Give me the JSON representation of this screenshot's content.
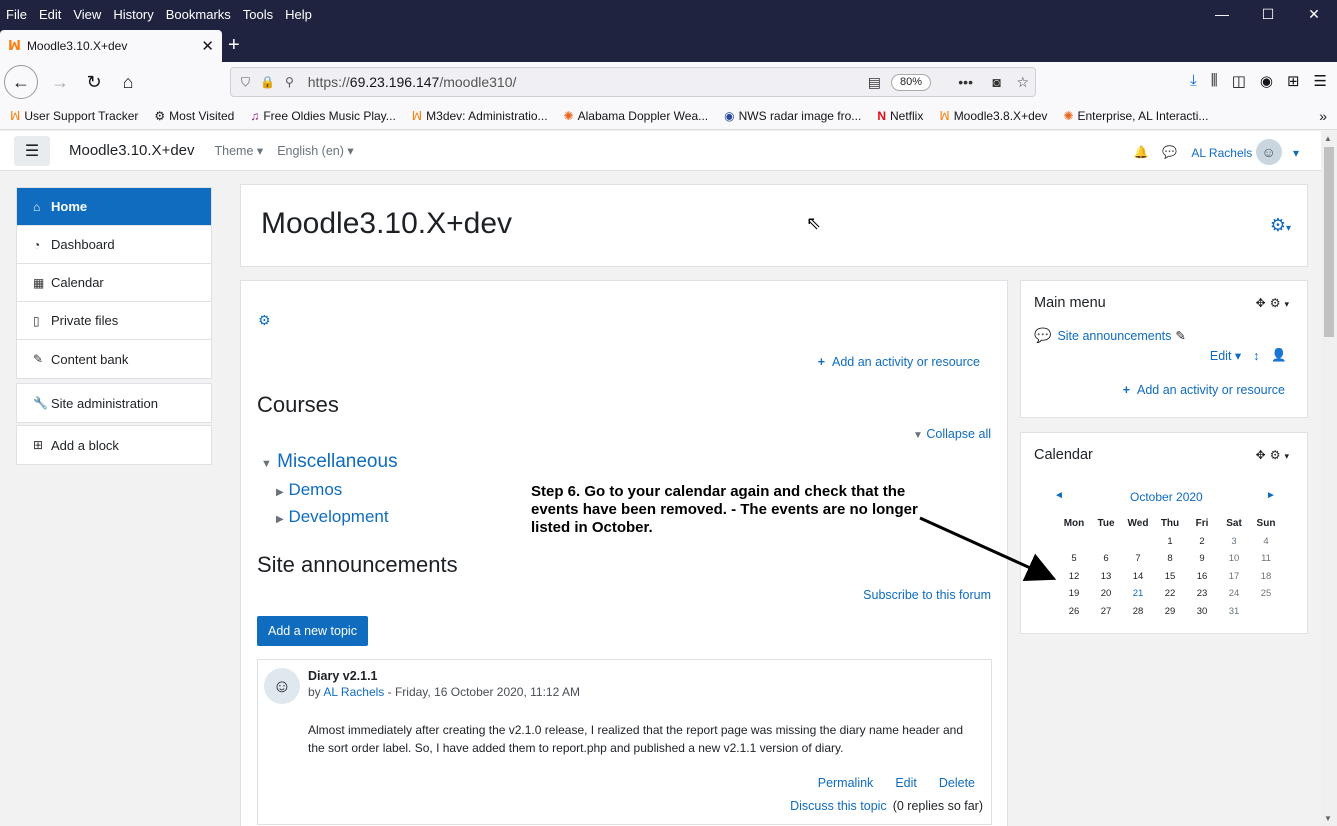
{
  "browser": {
    "menu": [
      "File",
      "Edit",
      "View",
      "History",
      "Bookmarks",
      "Tools",
      "Help"
    ],
    "tab_title": "Moodle3.10.X+dev",
    "url_prefix": "https://",
    "url_host": "69.23.196.147",
    "url_path": "/moodle310/",
    "zoom": "80%",
    "bookmarks": [
      {
        "icon": "ꟽ",
        "label": "User Support Tracker"
      },
      {
        "icon": "⚙",
        "label": "Most Visited"
      },
      {
        "icon": "♫",
        "label": "Free Oldies Music Play..."
      },
      {
        "icon": "ꟽ",
        "label": "M3dev: Administratio..."
      },
      {
        "icon": "✺",
        "label": "Alabama Doppler Wea..."
      },
      {
        "icon": "◉",
        "label": "NWS radar image fro..."
      },
      {
        "icon": "N",
        "label": "Netflix"
      },
      {
        "icon": "ꟽ",
        "label": "Moodle3.8.X+dev"
      },
      {
        "icon": "✺",
        "label": "Enterprise, AL Interacti..."
      }
    ]
  },
  "moodle_nav": {
    "site_name": "Moodle3.10.X+dev",
    "theme": "Theme",
    "language": "English (en)",
    "user": "AL Rachels"
  },
  "drawer": {
    "group1": [
      "Home",
      "Dashboard",
      "Calendar",
      "Private files",
      "Content bank"
    ],
    "group2": [
      "Site administration"
    ],
    "group3": [
      "Add a block"
    ]
  },
  "page": {
    "title": "Moodle3.10.X+dev",
    "add_activity": "Add an activity or resource",
    "courses_heading": "Courses",
    "collapse_all": "Collapse all",
    "category": "Miscellaneous",
    "subcats": [
      "Demos",
      "Development"
    ],
    "announcements_heading": "Site announcements",
    "subscribe": "Subscribe to this forum",
    "add_topic": "Add a new topic",
    "post": {
      "title": "Diary v2.1.1",
      "by_prefix": "by",
      "author": "AL Rachels",
      "date": "- Friday, 16 October 2020, 11:12 AM",
      "body": "Almost immediately after creating the v2.1.0 release, I realized that the report page was missing the diary name header and the sort order label. So, I have added them to report.php and published a new v2.1.1 version of diary.",
      "permalink": "Permalink",
      "edit": "Edit",
      "delete": "Delete",
      "discuss": "Discuss this topic",
      "replies": "(0 replies so far)"
    }
  },
  "main_menu_block": {
    "title": "Main menu",
    "item": "Site announcements",
    "edit": "Edit",
    "add_activity": "Add an activity or resource"
  },
  "calendar_block": {
    "title": "Calendar",
    "month": "October 2020",
    "days": [
      "Mon",
      "Tue",
      "Wed",
      "Thu",
      "Fri",
      "Sat",
      "Sun"
    ],
    "weeks": [
      [
        "",
        "",
        "",
        "1",
        "2",
        "3",
        "4"
      ],
      [
        "5",
        "6",
        "7",
        "8",
        "9",
        "10",
        "11"
      ],
      [
        "12",
        "13",
        "14",
        "15",
        "16",
        "17",
        "18"
      ],
      [
        "19",
        "20",
        "21",
        "22",
        "23",
        "24",
        "25"
      ],
      [
        "26",
        "27",
        "28",
        "29",
        "30",
        "31",
        ""
      ]
    ]
  },
  "annotation": "Step  6. Go to your calendar again and check that the events have been removed. - The events are no longer listed in October.",
  "colors": {
    "brand": "#0f6cbf",
    "firefox_dark": "#202340"
  }
}
